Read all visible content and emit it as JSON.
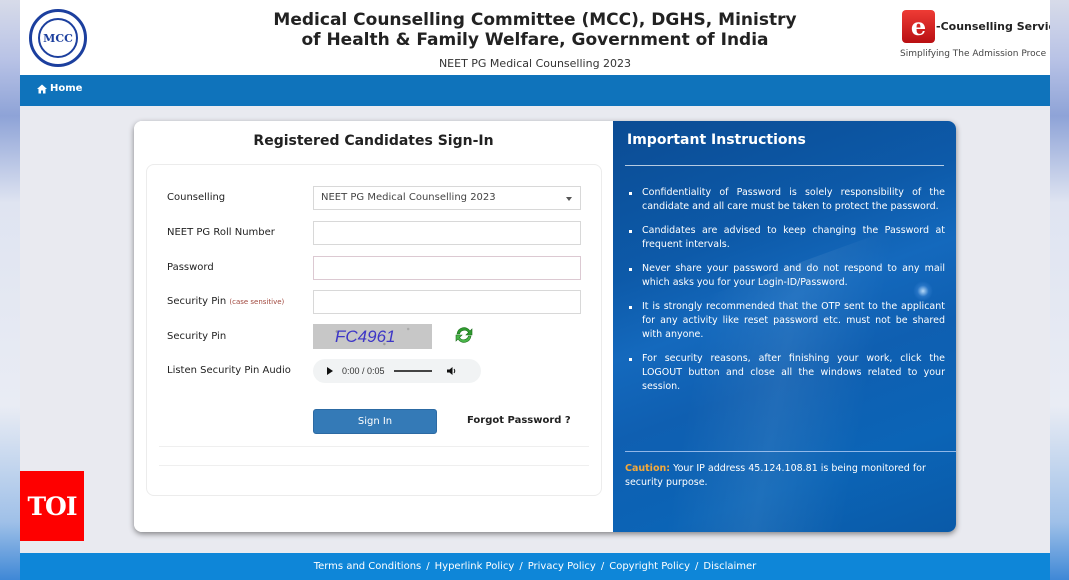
{
  "header": {
    "title_line1": "Medical Counselling Committee (MCC), DGHS, Ministry",
    "title_line2": "of Health & Family Welfare, Government of India",
    "subtitle": "NEET PG Medical Counselling 2023",
    "left_logo_text": "MCC",
    "right_logo": {
      "icon_letter": "e",
      "name": "-Counselling Services",
      "tagline": "Simplifying The Admission Proce"
    }
  },
  "nav": {
    "home_label": "Home",
    "home_icon": "home-icon"
  },
  "signin": {
    "title": "Registered Candidates Sign-In",
    "fields": [
      {
        "label": "Counselling",
        "type": "select",
        "value": "NEET PG Medical Counselling 2023"
      },
      {
        "label": "NEET PG Roll Number",
        "type": "text",
        "value": ""
      },
      {
        "label": "Password",
        "type": "password",
        "value": ""
      },
      {
        "label": "Security Pin",
        "hint": "(case sensitive)",
        "type": "text",
        "value": ""
      }
    ],
    "captcha_label": "Security Pin",
    "captcha_text": "FC4961",
    "refresh_icon": "refresh-icon",
    "audio_label": "Listen Security Pin Audio",
    "audio_time": "0:00 / 0:05",
    "signin_label": "Sign In",
    "forgot_label": "Forgot Password ?"
  },
  "instructions": {
    "title": "Important Instructions",
    "items": [
      "Confidentiality of Password is solely responsibility of the candidate and all care must be taken to protect the password.",
      "Candidates are advised to keep changing the Password at frequent intervals.",
      "Never share your password and do not respond to any mail which asks you for your Login-ID/Password.",
      "It is strongly recommended that the OTP sent to the applicant for any activity like reset password etc. must not be shared with anyone.",
      "For security reasons, after finishing your work, click the LOGOUT button and close all the windows related to your session."
    ],
    "caution_label": "Caution:",
    "caution_text": " Your IP address 45.124.108.81 is being monitored for security purpose."
  },
  "footer": {
    "links": [
      "Terms and Conditions",
      "Hyperlink Policy",
      "Privacy Policy",
      "Copyright Policy",
      "Disclaimer"
    ],
    "separator": "/"
  },
  "watermark": {
    "text": "TOI",
    "color": "#fe0000"
  },
  "colors": {
    "nav_blue": "#0f73bb",
    "footer_blue": "#0e86d8",
    "button_blue": "#347ab7",
    "caution_orange": "#f4a93a"
  }
}
